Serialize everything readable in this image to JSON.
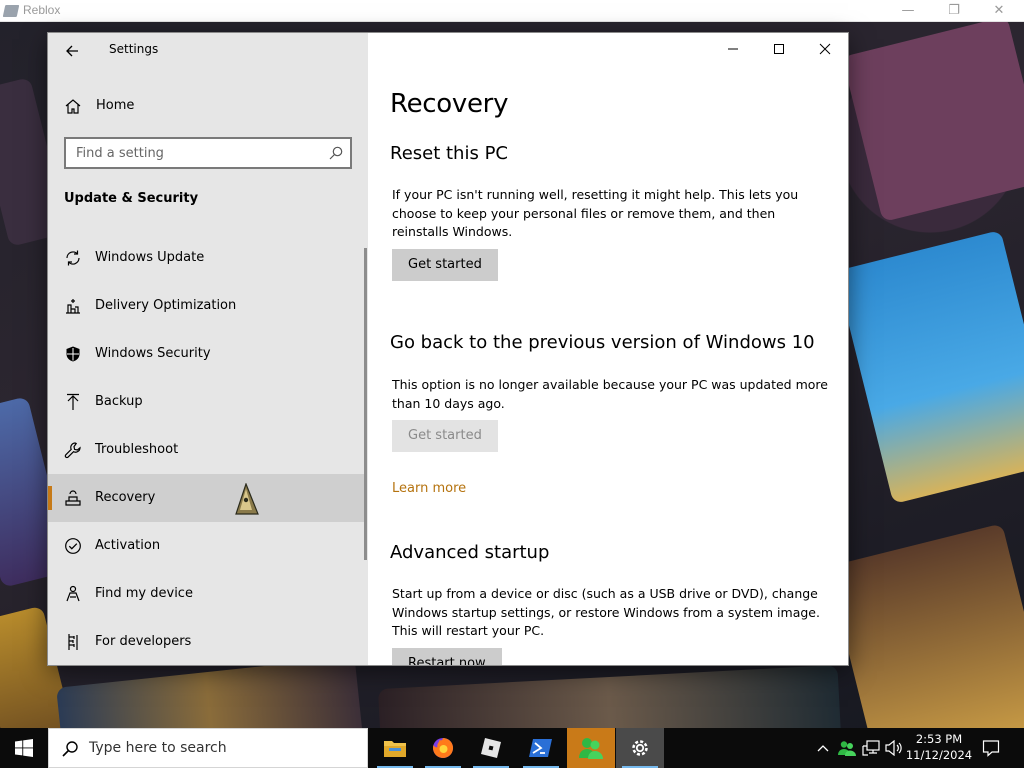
{
  "roblox": {
    "title": "Reblox",
    "controls": {
      "minimize": "—",
      "restore": "❐",
      "close": "✕"
    }
  },
  "settings": {
    "window_title": "Settings",
    "home_label": "Home",
    "search": {
      "placeholder": "Find a setting",
      "value": ""
    },
    "section": "Update & Security",
    "nav_items": [
      {
        "label": "Windows Update",
        "icon": "sync-icon"
      },
      {
        "label": "Delivery Optimization",
        "icon": "delivery-icon"
      },
      {
        "label": "Windows Security",
        "icon": "shield-icon"
      },
      {
        "label": "Backup",
        "icon": "backup-arrow-icon"
      },
      {
        "label": "Troubleshoot",
        "icon": "wrench-icon"
      },
      {
        "label": "Recovery",
        "icon": "recovery-icon",
        "active": true
      },
      {
        "label": "Activation",
        "icon": "check-circle-icon"
      },
      {
        "label": "Find my device",
        "icon": "person-pin-icon"
      },
      {
        "label": "For developers",
        "icon": "developer-icon"
      }
    ],
    "accent_color": "#c67a18"
  },
  "content": {
    "title": "Recovery",
    "reset": {
      "heading": "Reset this PC",
      "description": "If your PC isn't running well, resetting it might help. This lets you choose to keep your personal files or remove them, and then reinstalls Windows.",
      "button": "Get started"
    },
    "goback": {
      "heading": "Go back to the previous version of Windows 10",
      "description": "This option is no longer available because your PC was updated more than 10 days ago.",
      "button": "Get started",
      "button_disabled": true
    },
    "learn_more": "Learn more",
    "advanced": {
      "heading": "Advanced startup",
      "description": "Start up from a device or disc (such as a USB drive or DVD), change Windows startup settings, or restore Windows from a system image. This will restart your PC.",
      "button": "Restart now"
    },
    "link_color": "#b5730f"
  },
  "taskbar": {
    "search_text": "Type here to search",
    "apps": [
      "file-explorer-icon",
      "firefox-icon",
      "roblox-icon",
      "powershell-icon",
      "people-icon",
      "settings-gear-icon"
    ],
    "time": "2:53 PM",
    "date": "11/12/2024"
  }
}
